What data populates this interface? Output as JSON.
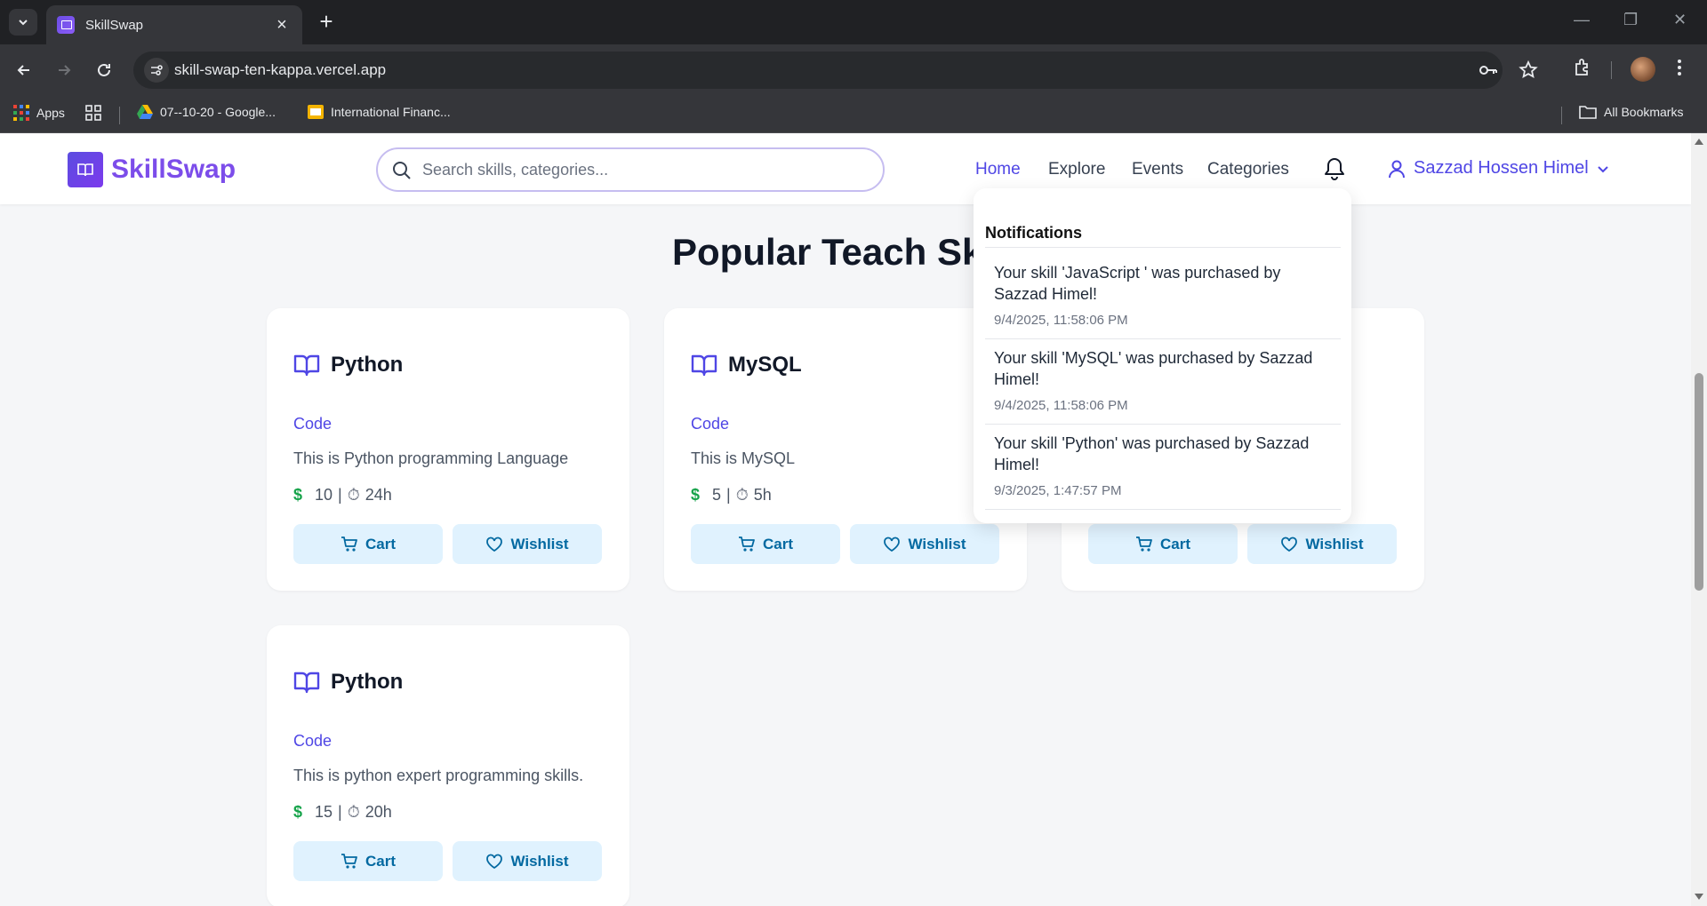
{
  "browser": {
    "tab_title": "SkillSwap",
    "url": "skill-swap-ten-kappa.vercel.app",
    "bookmarks": [
      {
        "label": "Apps"
      },
      {
        "label": "07--10-20 - Google..."
      },
      {
        "label": "International Financ..."
      }
    ],
    "all_bookmarks": "All Bookmarks"
  },
  "header": {
    "logo_text": "SkillSwap",
    "search_placeholder": "Search skills, categories...",
    "nav": [
      "Home",
      "Explore",
      "Events",
      "Categories"
    ],
    "user_name": "Sazzad Hossen Himel"
  },
  "main": {
    "heading": "Popular Teach Skills",
    "cards": [
      {
        "title": "Python",
        "category": "Code",
        "description": "This is Python programming Language",
        "price": "10",
        "duration": "24h",
        "cart": "Cart",
        "wishlist": "Wishlist"
      },
      {
        "title": "MySQL",
        "category": "Code",
        "description": "This is MySQL",
        "price": "5",
        "duration": "5h",
        "cart": "Cart",
        "wishlist": "Wishlist"
      },
      {
        "title": "",
        "category": "",
        "description": "",
        "price": "",
        "duration": "",
        "cart": "Cart",
        "wishlist": "Wishlist"
      },
      {
        "title": "Python",
        "category": "Code",
        "description": "This is python expert programming skills.",
        "price": "15",
        "duration": "20h",
        "cart": "Cart",
        "wishlist": "Wishlist"
      }
    ]
  },
  "notifications": {
    "title": "Notifications",
    "items": [
      {
        "message": "Your skill 'JavaScript ' was purchased by Sazzad Himel!",
        "time": "9/4/2025, 11:58:06 PM"
      },
      {
        "message": "Your skill 'MySQL' was purchased by Sazzad Himel!",
        "time": "9/4/2025, 11:58:06 PM"
      },
      {
        "message": "Your skill 'Python' was purchased by Sazzad Himel!",
        "time": "9/3/2025, 1:47:57 PM"
      }
    ]
  },
  "colors": {
    "brand": "#7c4dea",
    "accent": "#4f46e5",
    "button_bg": "#e0f2fe",
    "button_text": "#0369a1"
  }
}
